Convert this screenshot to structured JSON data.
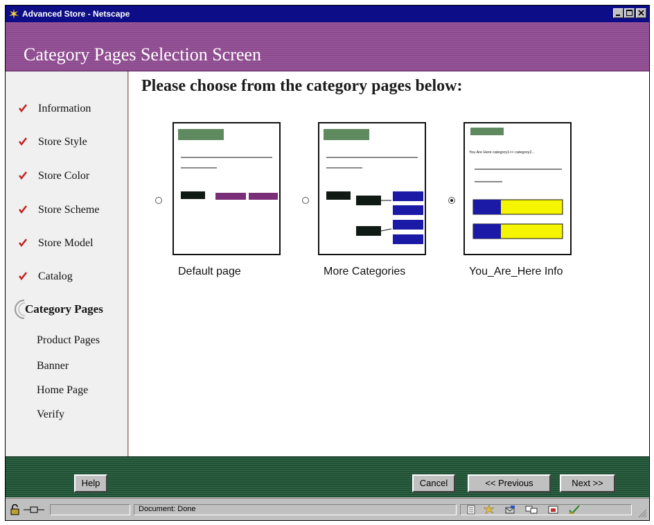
{
  "window": {
    "title": "Advanced Store - Netscape"
  },
  "header": {
    "heading": "Category Pages Selection Screen"
  },
  "sidebar": {
    "steps": [
      {
        "label": "Information",
        "state": "done"
      },
      {
        "label": "Store Style",
        "state": "done"
      },
      {
        "label": "Store Color",
        "state": "done"
      },
      {
        "label": "Store Scheme",
        "state": "done"
      },
      {
        "label": "Store Model",
        "state": "done"
      },
      {
        "label": "Catalog",
        "state": "done"
      },
      {
        "label": "Category Pages",
        "state": "current"
      },
      {
        "label": "Product Pages",
        "state": "pending"
      },
      {
        "label": "Banner",
        "state": "pending"
      },
      {
        "label": "Home Page",
        "state": "pending"
      },
      {
        "label": "Verify",
        "state": "pending"
      }
    ]
  },
  "main": {
    "prompt": "Please choose from the category pages below:",
    "options": [
      {
        "caption": "Default page",
        "selected": false
      },
      {
        "caption": "More Categories",
        "selected": false
      },
      {
        "caption": "You_Are_Here Info",
        "selected": true,
        "preview_text": "You Are Here category1>> category2..."
      }
    ]
  },
  "footer": {
    "help": "Help",
    "cancel": "Cancel",
    "previous": "<< Previous",
    "next": "Next >>"
  },
  "statusbar": {
    "status": "Document: Done"
  },
  "colors": {
    "title_bar": "#0d0d87",
    "header_purple": "#8b4a8d",
    "footer_green": "#1f4f34",
    "check_red": "#c41e1e",
    "thumb_green": "#5f8a5f",
    "thumb_purple": "#7a2e78",
    "thumb_blue": "#1a1aa6",
    "thumb_yellow": "#f5f500"
  }
}
